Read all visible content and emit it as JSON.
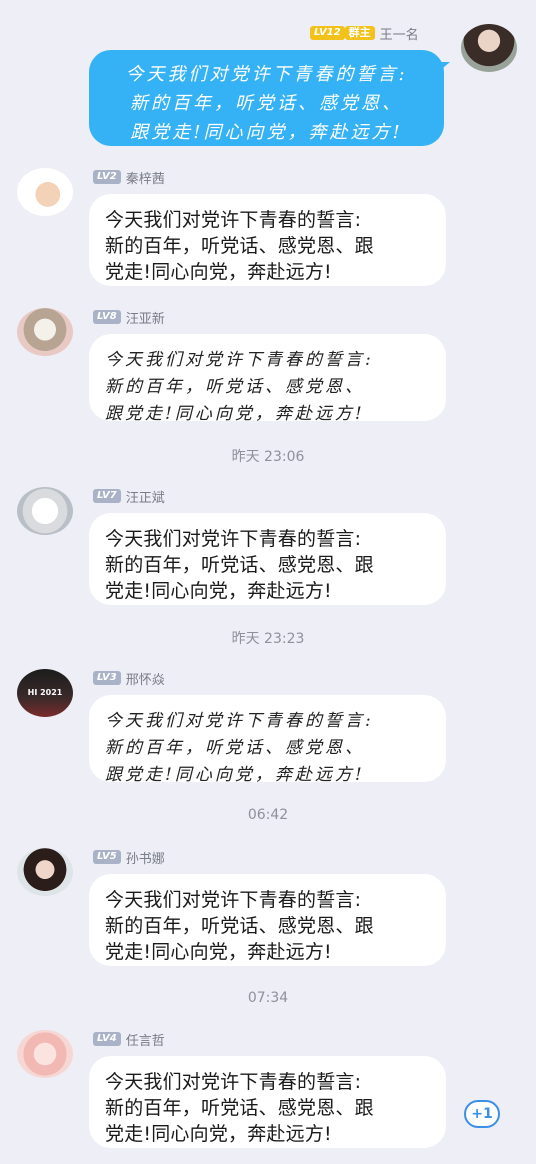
{
  "messages": [
    {
      "level": "LV12",
      "role": "群主",
      "name": "王一名",
      "text": "今天我们对党许下青春的誓言:\n新的百年，听党话、感党恩、\n跟党走!同心向党，奔赴远方!"
    },
    {
      "level": "LV2",
      "name": "秦梓茜",
      "text": "今天我们对党许下青春的誓言:\n新的百年，听党话、感党恩、跟\n党走!同心向党，奔赴远方!"
    },
    {
      "level": "LV8",
      "name": "汪亚新",
      "text": "今天我们对党许下青春的誓言:\n新的百年，听党话、感党恩、\n跟党走!同心向党，奔赴远方!"
    },
    {
      "level": "LV7",
      "name": "汪正斌",
      "text": "今天我们对党许下青春的誓言:\n新的百年，听党话、感党恩、跟\n党走!同心向党，奔赴远方!"
    },
    {
      "level": "LV3",
      "name": "邢怀焱",
      "text": "今天我们对党许下青春的誓言:\n新的百年，听党话、感党恩、\n跟党走!同心向党，奔赴远方!"
    },
    {
      "level": "LV5",
      "name": "孙书娜",
      "text": "今天我们对党许下青春的誓言:\n新的百年，听党话、感党恩、跟\n党走!同心向党，奔赴远方!"
    },
    {
      "level": "LV4",
      "name": "任言哲",
      "text": "今天我们对党许下青春的誓言:\n新的百年，听党话、感党恩、跟\n党走!同心向党，奔赴远方!"
    }
  ],
  "timestamps": [
    "昨天 23:06",
    "昨天 23:23",
    "06:42",
    "07:34"
  ],
  "avatar_texts": {
    "m4": "HI 2021"
  },
  "plus_one": "+1",
  "icons": {
    "plus_one": "plus-one-icon",
    "avatar": "avatar"
  }
}
